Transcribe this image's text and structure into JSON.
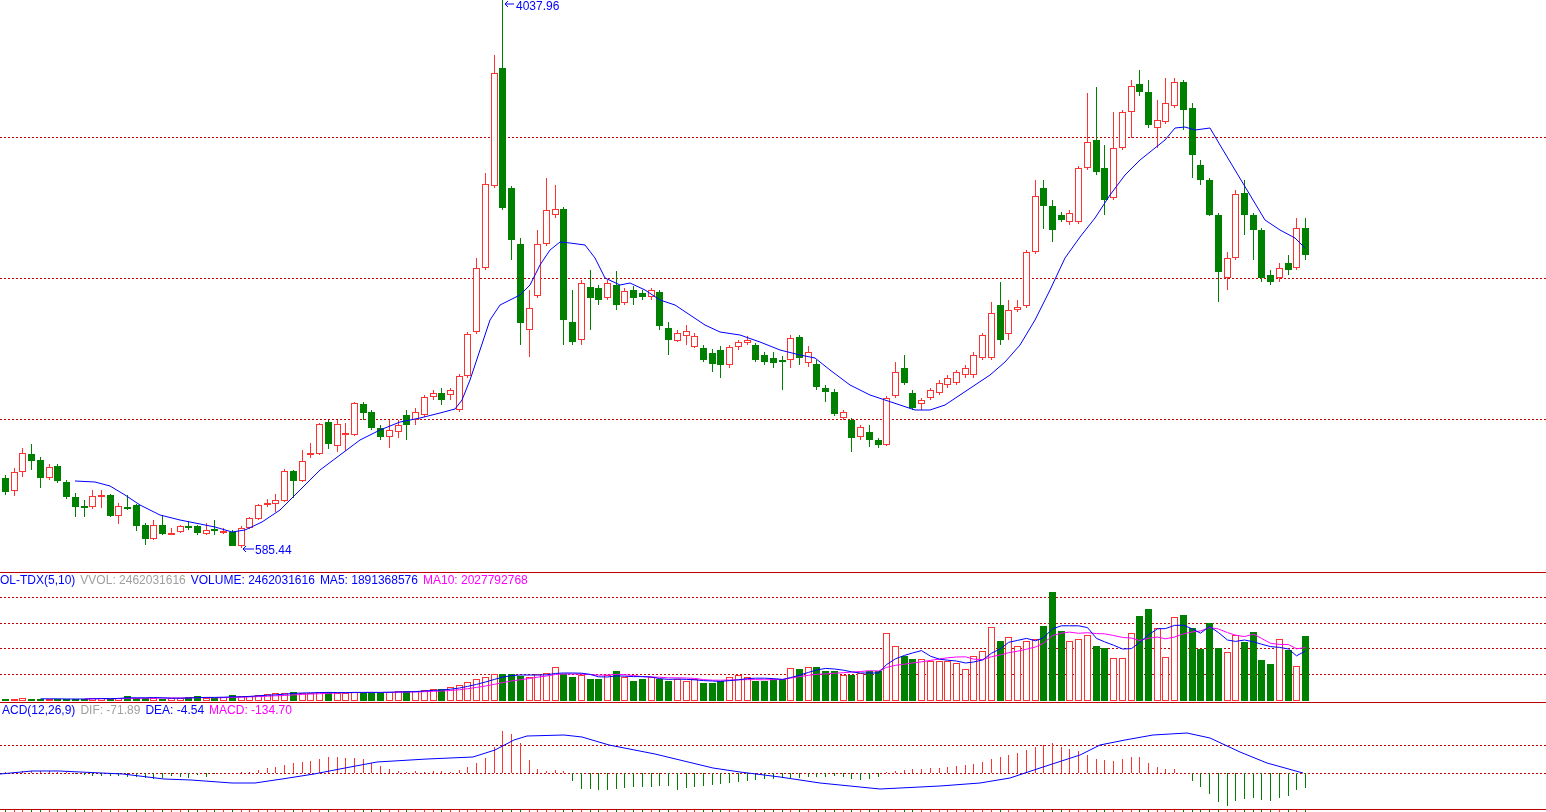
{
  "price_panel": {
    "high_label": "4037.96",
    "low_label": "585.44"
  },
  "volume_panel": {
    "legend": [
      {
        "text": "OL-TDX(5,10)",
        "color": "#0000ff"
      },
      {
        "text": "VVOL: 2462031616",
        "color": "#a0a0a0"
      },
      {
        "text": "VOLUME: 2462031616",
        "color": "#0000ff"
      },
      {
        "text": "MA5: 1891368576",
        "color": "#0000ff"
      },
      {
        "text": "MA10: 2027792768",
        "color": "#ff00ff"
      }
    ]
  },
  "macd_panel": {
    "legend": [
      {
        "text": "ACD(12,26,9)",
        "color": "#0000ff"
      },
      {
        "text": "DIF: -71.89",
        "color": "#a0a0a0"
      },
      {
        "text": "DEA: -4.54",
        "color": "#0000ff"
      },
      {
        "text": "MACD: -134.70",
        "color": "#ff00ff"
      }
    ]
  }
}
